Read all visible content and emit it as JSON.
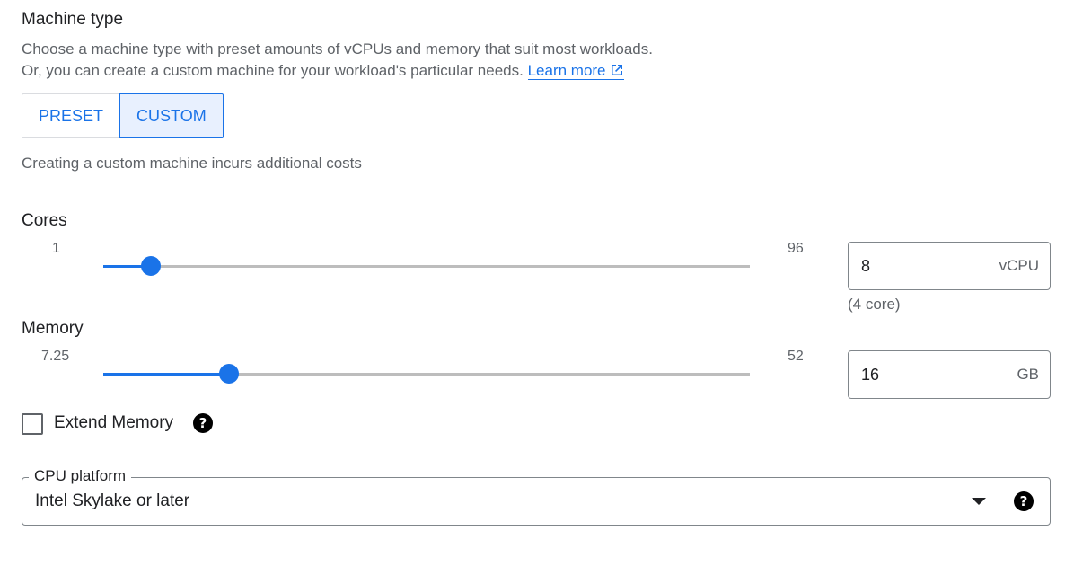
{
  "section": {
    "title": "Machine type",
    "desc_line1": "Choose a machine type with preset amounts of vCPUs and memory that suit most workloads.",
    "desc_line2": "Or, you can create a custom machine for your workload's particular needs.",
    "learn_more": "Learn more"
  },
  "toggle": {
    "preset": "PRESET",
    "custom": "CUSTOM",
    "selected": "CUSTOM"
  },
  "custom_note": "Creating a custom machine incurs additional costs",
  "cores": {
    "label": "Cores",
    "min": "1",
    "max": "96",
    "value": "8",
    "unit": "vCPU",
    "helper": "(4 core)",
    "slider_fraction": 0.074
  },
  "memory": {
    "label": "Memory",
    "min": "7.25",
    "max": "52",
    "value": "16",
    "unit": "GB",
    "slider_fraction": 0.195
  },
  "extend_memory": {
    "label": "Extend Memory",
    "checked": false
  },
  "cpu_platform": {
    "label": "CPU platform",
    "value": "Intel Skylake or later"
  },
  "colors": {
    "accent": "#1a73e8",
    "text": "#202124",
    "muted": "#5f6368"
  }
}
